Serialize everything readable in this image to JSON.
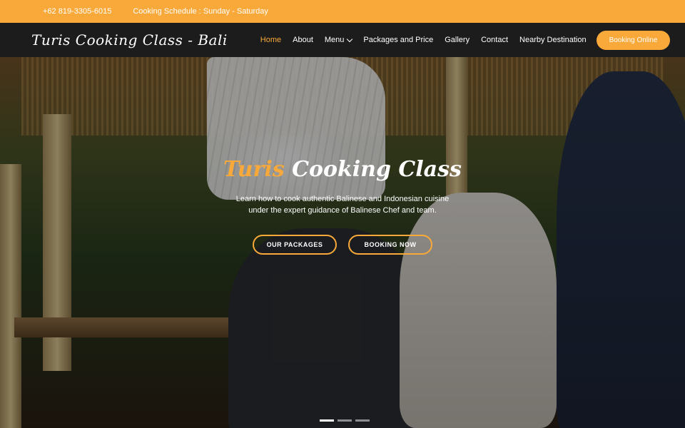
{
  "topbar": {
    "phone": "+62 819-3305-6015",
    "schedule": "Cooking Schedule : Sunday - Saturday"
  },
  "navbar": {
    "brand": "Turis Cooking Class - Bali",
    "items": [
      {
        "label": "Home",
        "active": true
      },
      {
        "label": "About"
      },
      {
        "label": "Menu",
        "has_dropdown": true
      },
      {
        "label": "Packages and Price"
      },
      {
        "label": "Gallery"
      },
      {
        "label": "Contact"
      },
      {
        "label": "Nearby Destination"
      }
    ],
    "cta": "Booking Online"
  },
  "hero": {
    "title_accent": "Turis",
    "title_rest": "Cooking Class",
    "description": "Learn how to cook authentic Balinese and Indonesian cuisine under the expert guidance of Balinese Chef and team.",
    "btn_packages": "OUR PACKAGES",
    "btn_booking": "BOOKING NOW",
    "slides": 3,
    "active_slide": 1
  },
  "colors": {
    "accent": "#f9a93a",
    "nav_bg": "#1c1c1c"
  }
}
